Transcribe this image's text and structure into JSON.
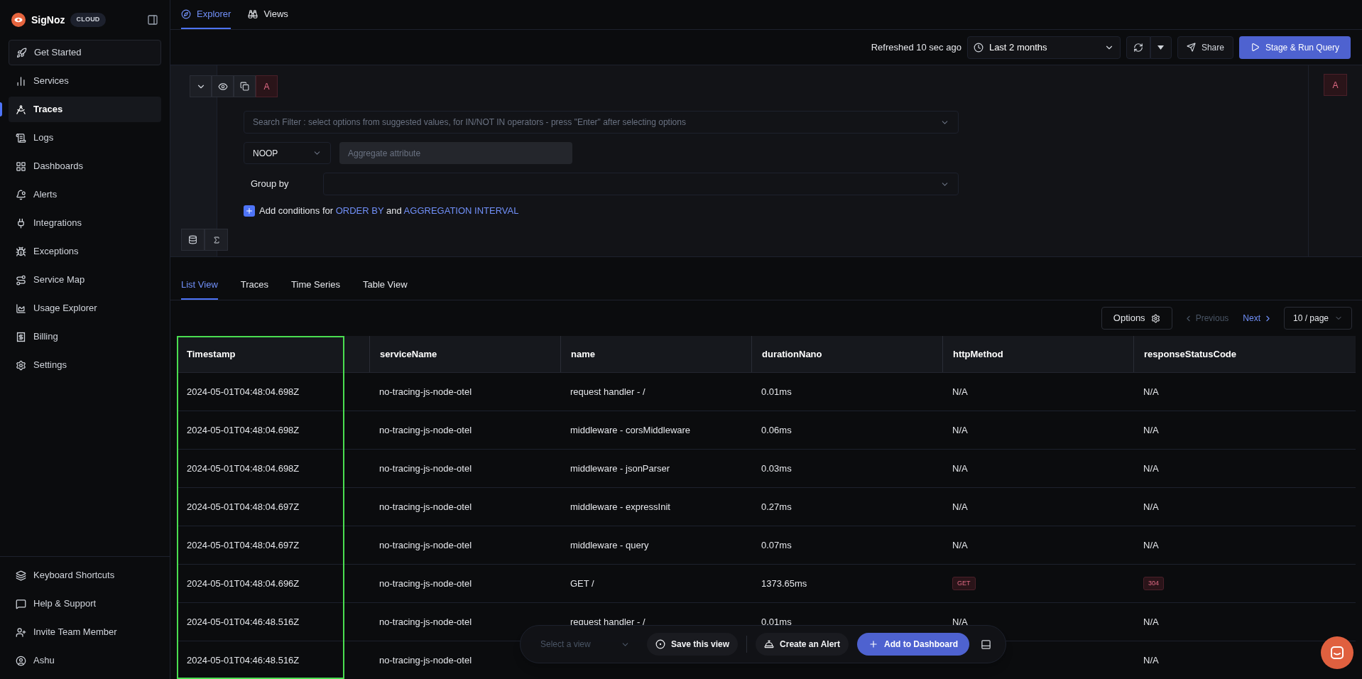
{
  "sidebar": {
    "brand": "SigNoz",
    "badge": "CLOUD",
    "nav": [
      {
        "label": "Get Started",
        "selected": false,
        "kind": "boxed"
      },
      {
        "label": "Services",
        "selected": false,
        "kind": "plain"
      },
      {
        "label": "Traces",
        "selected": true,
        "kind": "plain"
      },
      {
        "label": "Logs",
        "selected": false,
        "kind": "plain"
      },
      {
        "label": "Dashboards",
        "selected": false,
        "kind": "plain"
      },
      {
        "label": "Alerts",
        "selected": false,
        "kind": "plain"
      },
      {
        "label": "Integrations",
        "selected": false,
        "kind": "plain"
      },
      {
        "label": "Exceptions",
        "selected": false,
        "kind": "plain"
      },
      {
        "label": "Service Map",
        "selected": false,
        "kind": "plain"
      },
      {
        "label": "Usage Explorer",
        "selected": false,
        "kind": "plain"
      },
      {
        "label": "Billing",
        "selected": false,
        "kind": "plain"
      },
      {
        "label": "Settings",
        "selected": false,
        "kind": "plain"
      }
    ],
    "footer": [
      {
        "label": "Keyboard Shortcuts"
      },
      {
        "label": "Help & Support"
      },
      {
        "label": "Invite Team Member"
      },
      {
        "label": "Ashu"
      }
    ]
  },
  "top_tabs": [
    {
      "label": "Explorer",
      "selected": true
    },
    {
      "label": "Views",
      "selected": false
    }
  ],
  "toolbar": {
    "refreshed": "Refreshed 10 sec ago",
    "time_range": "Last 2 months",
    "share": "Share",
    "run": "Stage & Run Query"
  },
  "query": {
    "name": "A",
    "side_label": "A",
    "search_placeholder": "Search Filter : select options from suggested values, for IN/NOT IN operators - press \"Enter\" after selecting options",
    "operator": "NOOP",
    "aggregate_placeholder": "Aggregate attribute",
    "group_by": "Group by",
    "conditions_text": "Add conditions for",
    "order_by": "ORDER BY",
    "and_text": "and",
    "interval": "AGGREGATION INTERVAL"
  },
  "view_tabs": [
    {
      "label": "List View",
      "selected": true
    },
    {
      "label": "Traces",
      "selected": false
    },
    {
      "label": "Time Series",
      "selected": false
    },
    {
      "label": "Table View",
      "selected": false
    }
  ],
  "pagination": {
    "options": "Options",
    "previous": "Previous",
    "previous_disabled": true,
    "next": "Next",
    "page_size": "10 / page"
  },
  "table": {
    "columns": [
      {
        "label": "Timestamp",
        "highlighted": true
      },
      {
        "label": "serviceName",
        "highlighted": false
      },
      {
        "label": "name",
        "highlighted": false
      },
      {
        "label": "durationNano",
        "highlighted": false
      },
      {
        "label": "httpMethod",
        "highlighted": false
      },
      {
        "label": "responseStatusCode",
        "highlighted": false
      }
    ],
    "rows": [
      {
        "cells": [
          {
            "text": "2024-05-01T04:48:04.698Z",
            "kind": "text"
          },
          {
            "text": "no-tracing-js-node-otel",
            "kind": "text"
          },
          {
            "text": "request handler - /",
            "kind": "text"
          },
          {
            "text": "0.01ms",
            "kind": "text"
          },
          {
            "text": "N/A",
            "kind": "text"
          },
          {
            "text": "N/A",
            "kind": "text"
          }
        ]
      },
      {
        "cells": [
          {
            "text": "2024-05-01T04:48:04.698Z",
            "kind": "text"
          },
          {
            "text": "no-tracing-js-node-otel",
            "kind": "text"
          },
          {
            "text": "middleware - corsMiddleware",
            "kind": "text"
          },
          {
            "text": "0.06ms",
            "kind": "text"
          },
          {
            "text": "N/A",
            "kind": "text"
          },
          {
            "text": "N/A",
            "kind": "text"
          }
        ]
      },
      {
        "cells": [
          {
            "text": "2024-05-01T04:48:04.698Z",
            "kind": "text"
          },
          {
            "text": "no-tracing-js-node-otel",
            "kind": "text"
          },
          {
            "text": "middleware - jsonParser",
            "kind": "text"
          },
          {
            "text": "0.03ms",
            "kind": "text"
          },
          {
            "text": "N/A",
            "kind": "text"
          },
          {
            "text": "N/A",
            "kind": "text"
          }
        ]
      },
      {
        "cells": [
          {
            "text": "2024-05-01T04:48:04.697Z",
            "kind": "text"
          },
          {
            "text": "no-tracing-js-node-otel",
            "kind": "text"
          },
          {
            "text": "middleware - expressInit",
            "kind": "text"
          },
          {
            "text": "0.27ms",
            "kind": "text"
          },
          {
            "text": "N/A",
            "kind": "text"
          },
          {
            "text": "N/A",
            "kind": "text"
          }
        ]
      },
      {
        "cells": [
          {
            "text": "2024-05-01T04:48:04.697Z",
            "kind": "text"
          },
          {
            "text": "no-tracing-js-node-otel",
            "kind": "text"
          },
          {
            "text": "middleware - query",
            "kind": "text"
          },
          {
            "text": "0.07ms",
            "kind": "text"
          },
          {
            "text": "N/A",
            "kind": "text"
          },
          {
            "text": "N/A",
            "kind": "text"
          }
        ]
      },
      {
        "cells": [
          {
            "text": "2024-05-01T04:48:04.696Z",
            "kind": "text"
          },
          {
            "text": "no-tracing-js-node-otel",
            "kind": "text"
          },
          {
            "text": "GET /",
            "kind": "text"
          },
          {
            "text": "1373.65ms",
            "kind": "text"
          },
          {
            "text": "GET",
            "kind": "tag"
          },
          {
            "text": "304",
            "kind": "tag"
          }
        ]
      },
      {
        "cells": [
          {
            "text": "2024-05-01T04:46:48.516Z",
            "kind": "text"
          },
          {
            "text": "no-tracing-js-node-otel",
            "kind": "text"
          },
          {
            "text": "request handler - /",
            "kind": "text"
          },
          {
            "text": "0.01ms",
            "kind": "text"
          },
          {
            "text": "N/A",
            "kind": "text"
          },
          {
            "text": "N/A",
            "kind": "text"
          }
        ]
      },
      {
        "cells": [
          {
            "text": "2024-05-01T04:46:48.516Z",
            "kind": "text"
          },
          {
            "text": "no-tracing-js-node-otel",
            "kind": "text"
          },
          {
            "kind": "hidden"
          },
          {
            "kind": "hidden"
          },
          {
            "kind": "hidden"
          },
          {
            "text": "N/A",
            "kind": "text"
          }
        ]
      }
    ]
  },
  "bottom_bar": {
    "view_placeholder": "Select a view",
    "save": "Save this view",
    "alert": "Create an Alert",
    "dashboard": "Add to Dashboard"
  }
}
